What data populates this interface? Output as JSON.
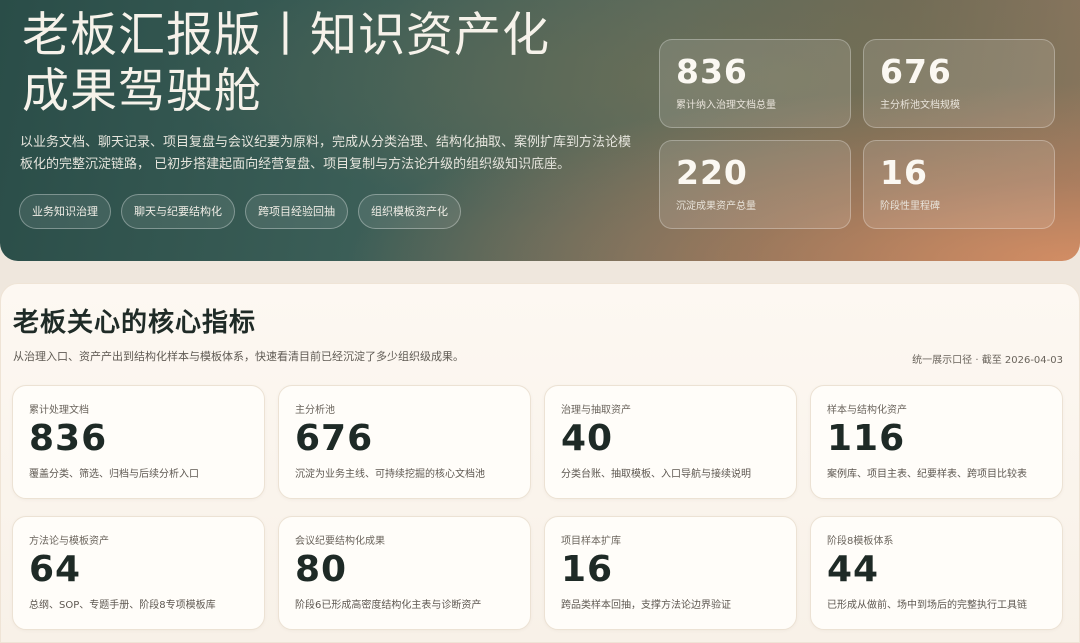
{
  "hero": {
    "title_line1": "老板汇报版丨知识资产化",
    "title_line2": "成果驾驶舱",
    "description": "以业务文档、聊天记录、项目复盘与会议纪要为原料，完成从分类治理、结构化抽取、案例扩库到方法论模板化的完整沉淀链路， 已初步搭建起面向经营复盘、项目复制与方法论升级的组织级知识底座。",
    "tags": [
      "业务知识治理",
      "聊天与纪要结构化",
      "跨项目经验回抽",
      "组织模板资产化"
    ],
    "stats": [
      {
        "value": "836",
        "label": "累计纳入治理文档总量"
      },
      {
        "value": "676",
        "label": "主分析池文档规模"
      },
      {
        "value": "220",
        "label": "沉淀成果资产总量"
      },
      {
        "value": "16",
        "label": "阶段性里程碑"
      }
    ]
  },
  "section": {
    "title": "老板关心的核心指标",
    "subtitle": "从治理入口、资产产出到结构化样本与模板体系，快速看清目前已经沉淀了多少组织级成果。",
    "meta": "统一展示口径 · 截至 2026-04-03",
    "metrics": [
      {
        "name": "累计处理文档",
        "value": "836",
        "desc": "覆盖分类、筛选、归档与后续分析入口"
      },
      {
        "name": "主分析池",
        "value": "676",
        "desc": "沉淀为业务主线、可持续挖掘的核心文档池"
      },
      {
        "name": "治理与抽取资产",
        "value": "40",
        "desc": "分类台账、抽取模板、入口导航与接续说明"
      },
      {
        "name": "样本与结构化资产",
        "value": "116",
        "desc": "案例库、项目主表、纪要样表、跨项目比较表"
      },
      {
        "name": "方法论与模板资产",
        "value": "64",
        "desc": "总纲、SOP、专题手册、阶段8专项模板库"
      },
      {
        "name": "会议纪要结构化成果",
        "value": "80",
        "desc": "阶段6已形成高密度结构化主表与诊断资产"
      },
      {
        "name": "项目样本扩库",
        "value": "16",
        "desc": "跨品类样本回抽，支撑方法论边界验证"
      },
      {
        "name": "阶段8模板体系",
        "value": "44",
        "desc": "已形成从做前、场中到场后的完整执行工具链"
      }
    ]
  }
}
